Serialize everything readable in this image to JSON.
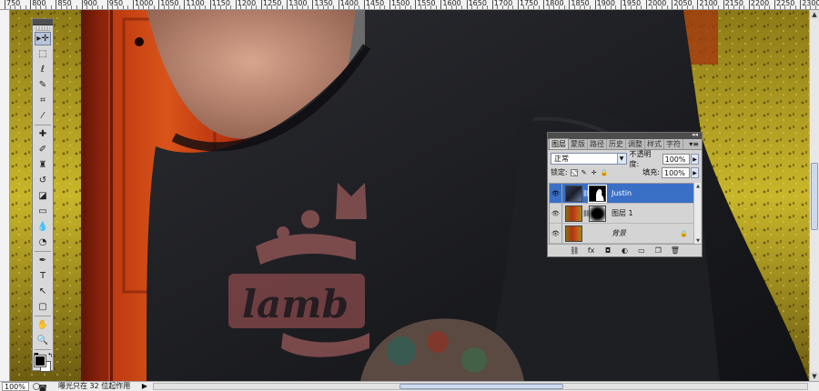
{
  "ruler": {
    "top_labels": [
      "750",
      "800",
      "850",
      "900",
      "950",
      "1000",
      "1050",
      "1100",
      "1150",
      "1200",
      "1250",
      "1300",
      "1350",
      "1400",
      "1450",
      "1500",
      "1550",
      "1600",
      "1650",
      "1700",
      "1750",
      "1800",
      "1850",
      "1900",
      "1950",
      "2000",
      "2050",
      "2100",
      "2150",
      "2200",
      "2250",
      "2300",
      "2350"
    ]
  },
  "toolbox": {
    "tools": [
      {
        "name": "move-tool",
        "glyph": "▸✛",
        "active": true
      },
      {
        "name": "marquee-tool",
        "glyph": "⬚"
      },
      {
        "name": "lasso-tool",
        "glyph": "ℓ"
      },
      {
        "name": "quick-selection-tool",
        "glyph": "✎"
      },
      {
        "name": "crop-tool",
        "glyph": "⌗"
      },
      {
        "name": "eyedropper-tool",
        "glyph": "⁄"
      },
      {
        "name": "sep"
      },
      {
        "name": "healing-brush-tool",
        "glyph": "✚"
      },
      {
        "name": "brush-tool",
        "glyph": "✐"
      },
      {
        "name": "clone-stamp-tool",
        "glyph": "♜"
      },
      {
        "name": "history-brush-tool",
        "glyph": "↺"
      },
      {
        "name": "eraser-tool",
        "glyph": "◪"
      },
      {
        "name": "gradient-tool",
        "glyph": "▭"
      },
      {
        "name": "blur-tool",
        "glyph": "💧"
      },
      {
        "name": "dodge-tool",
        "glyph": "◔"
      },
      {
        "name": "sep"
      },
      {
        "name": "pen-tool",
        "glyph": "✒"
      },
      {
        "name": "type-tool",
        "glyph": "T"
      },
      {
        "name": "path-selection-tool",
        "glyph": "↖"
      },
      {
        "name": "shape-tool",
        "glyph": "▢"
      },
      {
        "name": "sep"
      },
      {
        "name": "hand-tool",
        "glyph": "✋"
      },
      {
        "name": "zoom-tool",
        "glyph": "🔍"
      }
    ],
    "foreground_color": "#000000",
    "background_color": "#ffffff"
  },
  "layers_panel": {
    "tabs": [
      "图层",
      "蒙版",
      "路径",
      "历史",
      "调整",
      "样式",
      "字符"
    ],
    "active_tab": "图层",
    "blend_mode": "正常",
    "opacity_label": "不透明度:",
    "opacity_value": "100%",
    "lock_label": "锁定:",
    "fill_label": "填充:",
    "fill_value": "100%",
    "layers": [
      {
        "name": "Justin",
        "selected": true,
        "has_mask": true,
        "thumb": "person"
      },
      {
        "name": "图层 1",
        "selected": false,
        "has_mask": true,
        "thumb": "texture"
      },
      {
        "name": "背景",
        "selected": false,
        "has_mask": false,
        "locked": true,
        "thumb": "texture"
      }
    ],
    "footer_icons": [
      "link-icon",
      "fx-icon",
      "mask-icon",
      "adjustment-icon",
      "group-icon",
      "new-layer-icon",
      "trash-icon"
    ]
  },
  "statusbar": {
    "zoom": "100%",
    "info": "曝光只在 32 位起作用"
  },
  "colors": {
    "selection": "#3a6fc6",
    "panel_bg": "#d4d4d4",
    "shirt": "#1c1d20",
    "wall_yellow": "#b39a1a",
    "door_red": "#a72a0e"
  }
}
